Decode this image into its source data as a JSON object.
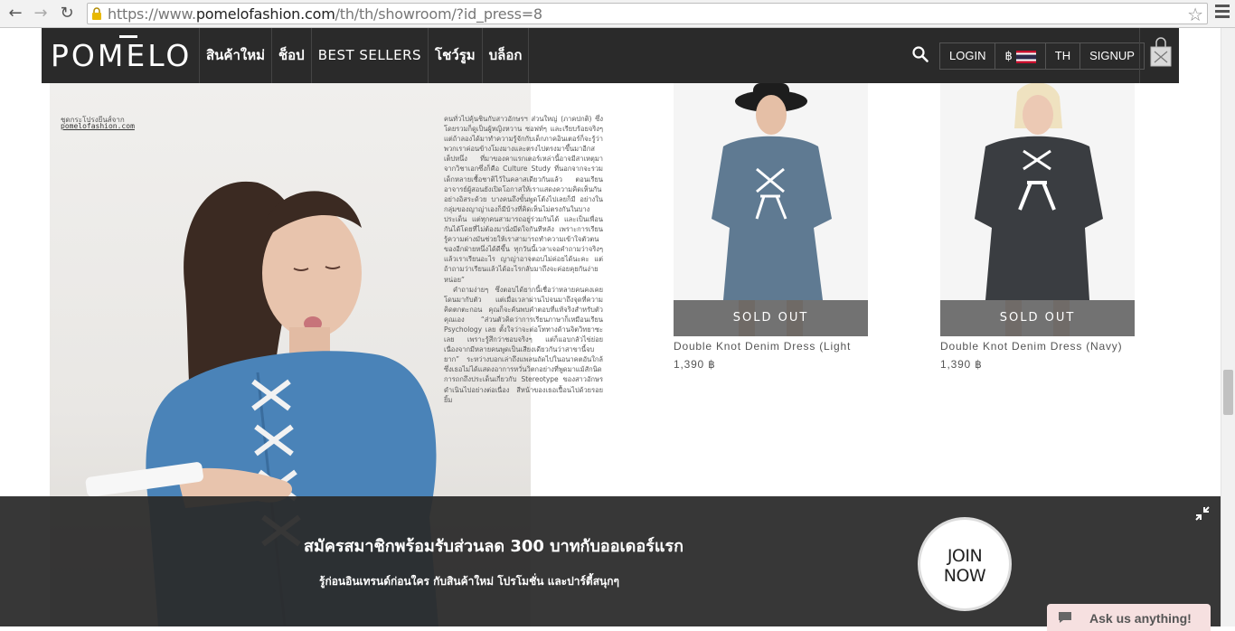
{
  "browser": {
    "url_prefix": "https://www.",
    "url_domain": "pomelofashion.com",
    "url_path": "/th/th/showroom/?id_press=8"
  },
  "header": {
    "logo": "POMELO",
    "nav": [
      "สินค้าใหม่",
      "ช็อป",
      "BEST SELLERS",
      "โชว์รูม",
      "บล็อก"
    ],
    "login": "LOGIN",
    "currency": "฿",
    "language": "TH",
    "signup": "SIGNUP"
  },
  "magazine": {
    "credit": "ชุดกระโปรงยีนส์จาก",
    "credit_link": "pomelofashion.com",
    "article_paragraphs": [
      "คนทั่วไปคุ้นชินกับสาวอักษรฯ ส่วนใหญ่ (ภาคปกติ) ซึ่งโดยรวมก็ดูเป็นผู้หญิงหวาน ซอฟท์ๆ และเรียบร้อยจริงๆ แต่ถ้าลองได้มาทำความรู้จักกับเด็กภาคอินเตอร์ก็จะรู้ว่าพวกเราค่อนข้างโมงมางและตรงไปตรงมาขึ้นมาอีกสเต็ปหนึ่ง ที่มาของคาแรกเตอร์เหล่านี้อาจมีสาเหตุมาจากวิชาเอกซึ่งก็คือ Culture Study ที่นอกจากจะรวมเด็กหลายเชื้อชาติไว้ในคลาสเดียวกันแล้ว ตอนเรียนอาจารย์ผู้สอนยังเปิดโอกาสให้เราแสดงความคิดเห็นกันอย่างอิสระด้วย บางคนถึงขั้นพูดโต้งไปเลยก็มี อย่างในกลุ่มของญาญ่าเองก็มีบ้างที่คิดเห็นไม่ตรงกันในบางประเด็น แต่ทุกคนสามารถอยู่ร่วมกันได้ และเป็นเพื่อนกันได้โดยที่ไม่ต้องมานั่งมีดใจกันทีหลัง เพราะการเรียนรู้ความต่างมันช่วยให้เราสามารถทำความเข้าใจตัวตนของอีกฝ่ายหนึ่งได้ดีขึ้น ทุกวันนี้เวลาเจอคำถามว่าจริงๆ แล้วเราเรียนอะไร ญาญ่าอาจตอบไม่ค่อยได้นะคะ แต่ถ้าถามว่าเรียนแล้วได้อะไรกลับมาถึงจะค่อยคุยกันง่ายหน่อย”",
      "คำถามง่ายๆ ซึ่งตอบได้ยากนี้เชื่อว่าหลายคนคงเคยโดนมากับตัว แต่เมื่อเวลาผ่านไปจนมาถึงจุดที่ความคิดตกตะกอน คุณก็จะค้นพบคำตอบที่แท้จริงสำหรับตัวคุณเอง “ส่วนตัวคิดว่าการเรียนภาษาก็เหมือนเรียน Psychology เลย ตั้งใจว่าจะต่อโททางด้านจิตวิทยาซะเลย เพราะรู้สึกว่าชอบจริงๆ แต่ก็แอบกลัวไข่ย่อยเนื่องจากมีหลายคนพูดเป็นเสียงเดียวกันว่าสาขานี้จบยาก” ระหว่างบอกเล่าถึงแพลนถัดไปในอนาคตอันใกล้ซึ่งเธอไม่ได้แสดงอาการหวั่นวิตกอย่างที่พูดมาแม้สักนิด การถกถึงประเด็นเกี่ยวกับ Stereotype ของสาวอักษรดำเนินไปอย่างต่อเนื่อง สีหน้าของเธอเปื้อนไปด้วยรอยยิ้ม"
    ]
  },
  "products": [
    {
      "name": "Double Knot Denim Dress (Light",
      "price": "1,390 ฿",
      "status": "SOLD OUT"
    },
    {
      "name": "Double Knot Denim Dress (Navy)",
      "price": "1,390 ฿",
      "status": "SOLD OUT"
    }
  ],
  "banner": {
    "title": "สมัครสมาชิกพร้อมรับส่วนลด 300 บาทกับออเดอร์แรก",
    "subtitle": "รู้ก่อนอินเทรนด์ก่อนใคร กับสินค้าใหม่ โปรโมชั่น และปาร์ตี้สนุกๆ",
    "join_line1": "JOIN",
    "join_line2": "NOW"
  },
  "chat": {
    "label": "Ask us anything!"
  },
  "colors": {
    "header_bg": "#2a2a2a",
    "banner_bg": "#2a2a2a",
    "chat_bg": "#f6e0e0"
  }
}
